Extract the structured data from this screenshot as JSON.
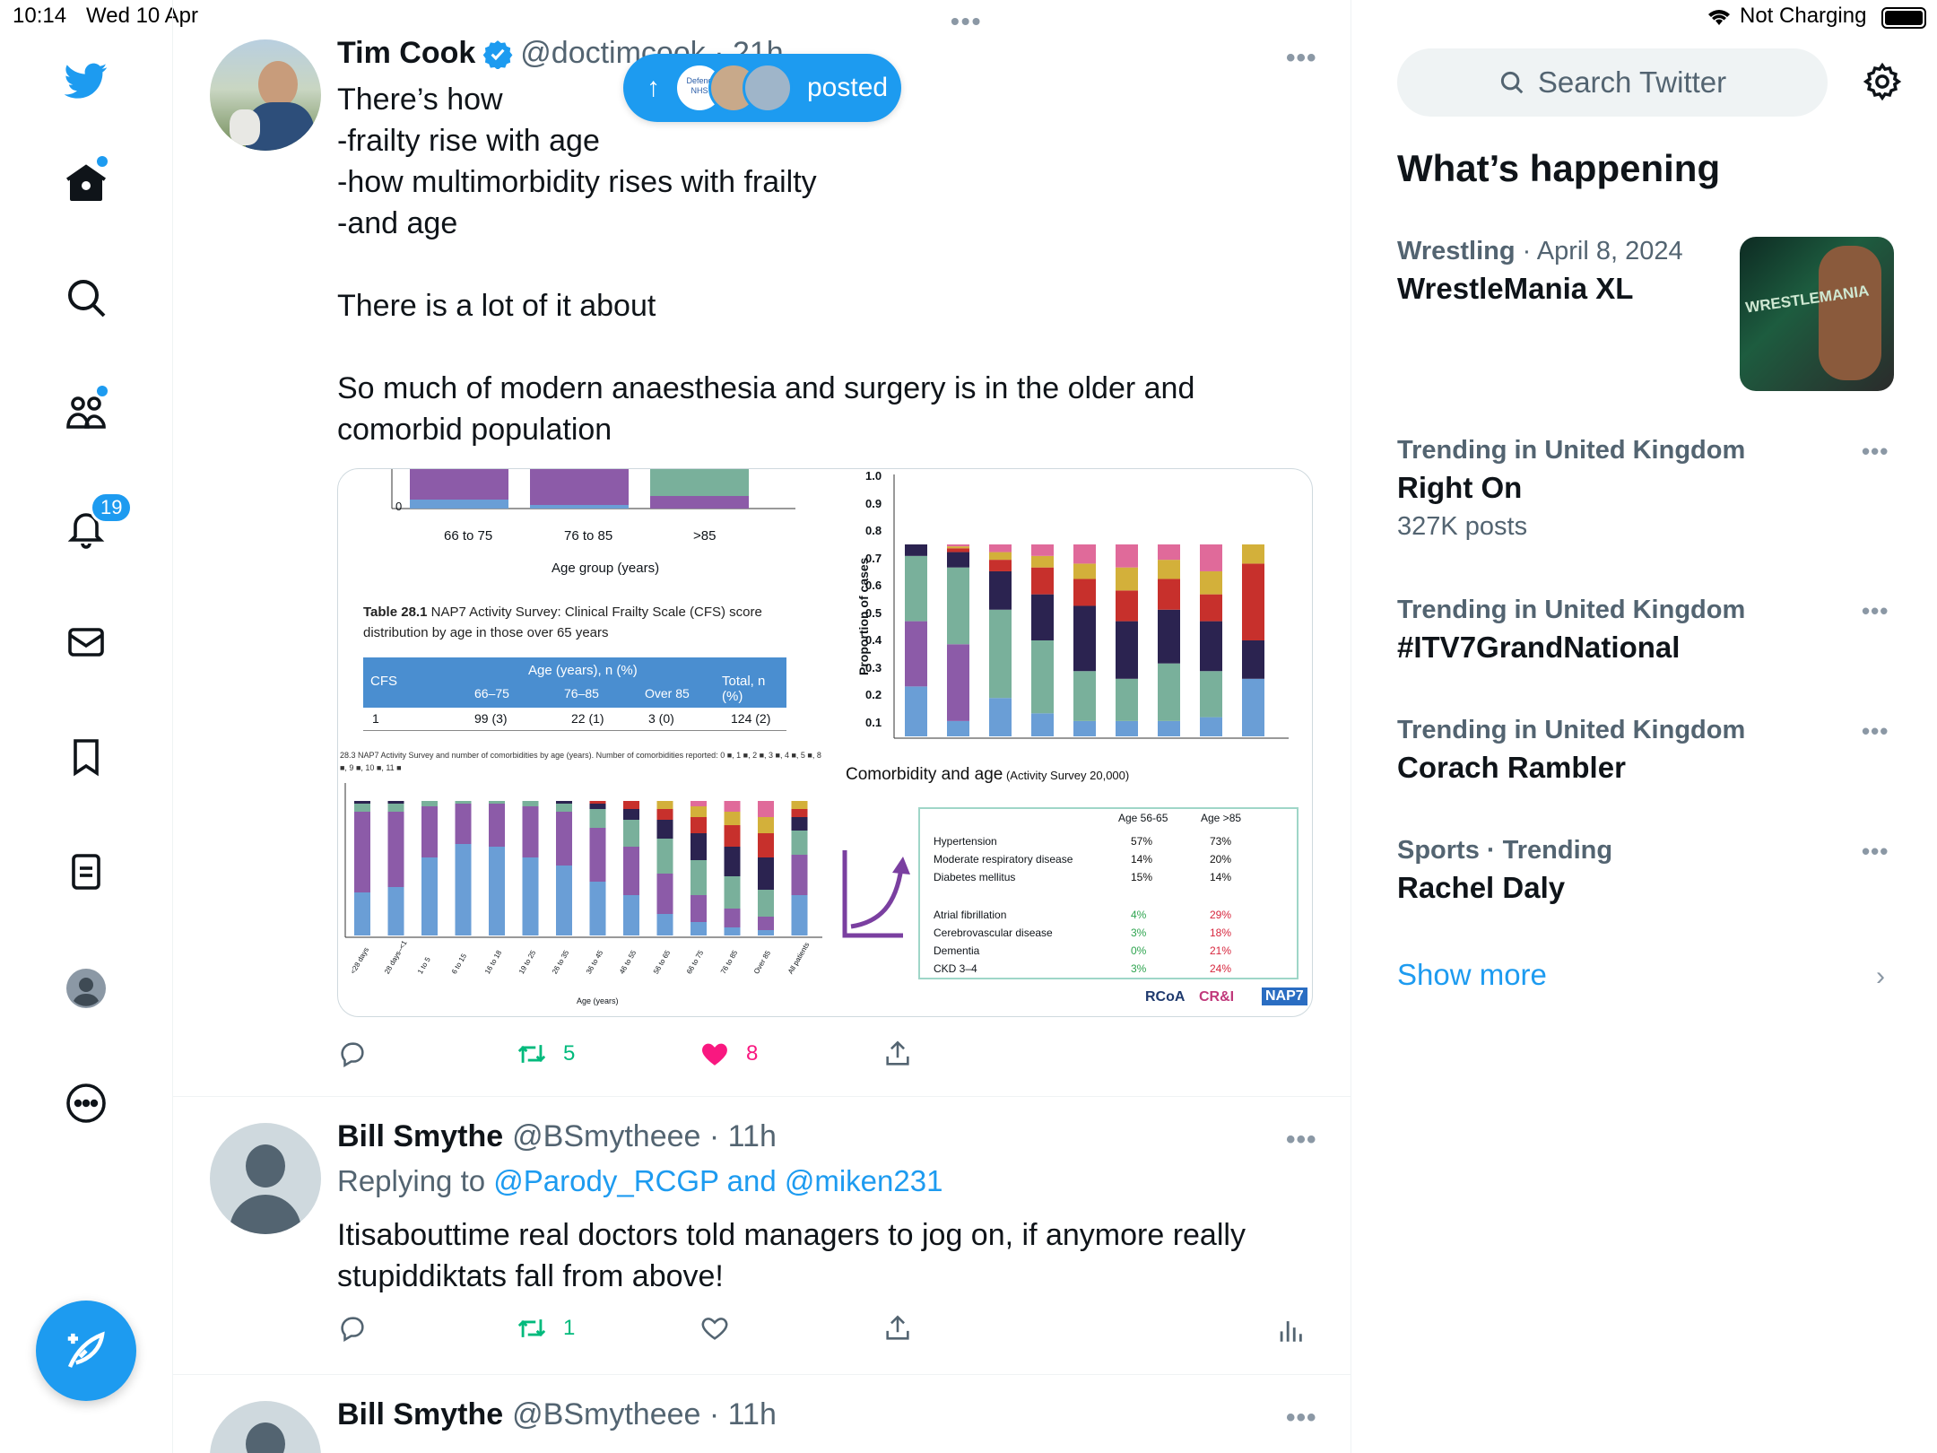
{
  "status_bar": {
    "time": "10:14",
    "date": "Wed 10 Apr",
    "battery_text": "Not Charging"
  },
  "nav": {
    "notifications_badge": "19"
  },
  "pill": {
    "label": "posted",
    "avatar_text": "Defend NHS"
  },
  "tweet1": {
    "name": "Tim Cook",
    "handle": "@doctimcook · 21h",
    "text": "There’s how\n-frailty rise with age\n-how multimorbidity rises with frailty\n-and age\n\nThere is a lot of it about\n\nSo much of modern anaesthesia and surgery is in the older and\ncomorbid population",
    "retweets": "5",
    "likes": "8"
  },
  "tweet2": {
    "name": "Bill Smythe",
    "handle": "@BSmytheee · 11h",
    "replying_prefix": "Replying to",
    "replying_users": "@Parody_RCGP and @miken231",
    "text": "Itisabouttime real doctors told managers to jog on, if anymore really\nstupiddiktats fall from above!",
    "retweets": "1"
  },
  "tweet3": {
    "name": "Bill Smythe",
    "handle": "@BSmytheee · 11h"
  },
  "media": {
    "top_left": {
      "y_zero": "0",
      "categories": [
        "66 to 75",
        "76 to 85",
        ">85"
      ],
      "xlabel": "Age group (years)"
    },
    "table": {
      "caption_bold": "Table 28.1",
      "caption": " NAP7 Activity Survey: Clinical Frailty Scale (CFS) score distribution by age in those over 65 years",
      "header_cfs": "CFS",
      "header_age": "Age (years), n (%)",
      "header_total": "Total, n (%)",
      "sub_headers": [
        "66–75",
        "76–85",
        "Over 85"
      ],
      "row": [
        "1",
        "99 (3)",
        "22 (1)",
        "3 (0)",
        "124 (2)"
      ]
    },
    "bottom_left": {
      "caption": "28.3 NAP7 Activity Survey and number of comorbidities by age (years). Number of comorbidities reported: 0 ■, 1 ■, 2 ■, 3 ■, 4 ■, 5 ■, 8 ■, 9 ■, 10 ■, 11 ■",
      "xlabels": [
        "<28 days",
        "28 days–<1",
        "1 to 5",
        "6 to 15",
        "16 to 18",
        "19 to 25",
        "26 to 35",
        "36 to 45",
        "46 to 55",
        "56 to 65",
        "66 to 75",
        "76 to 85",
        "Over 85",
        "All patients"
      ],
      "xlabel": "Age (years)"
    },
    "top_right": {
      "ylabel": "Proportion of cases",
      "yticks": [
        "1.0",
        "0.9",
        "0.8",
        "0.7",
        "0.6",
        "0.5",
        "0.4",
        "0.3",
        "0.2",
        "0.1"
      ]
    },
    "comorbidity": {
      "title": "Comorbidity and age",
      "subtitle": " (Activity Survey 20,000)",
      "col1": "Age 56-65",
      "col2": "Age >85",
      "rows": [
        [
          "Hypertension",
          "57%",
          "73%"
        ],
        [
          "Moderate respiratory disease",
          "14%",
          "20%"
        ],
        [
          "Diabetes mellitus",
          "15%",
          "14%"
        ],
        [
          "Atrial fibrillation",
          "4%",
          "29%"
        ],
        [
          "Cerebrovascular disease",
          "3%",
          "18%"
        ],
        [
          "Dementia",
          "0%",
          "21%"
        ],
        [
          "CKD 3–4",
          "3%",
          "24%"
        ]
      ]
    },
    "logos": [
      "RCoA",
      "CR&I",
      "NAP7"
    ]
  },
  "right": {
    "search_placeholder": "Search Twitter",
    "section_title": "What’s happening",
    "trends": [
      {
        "meta_cat": "Wrestling",
        "meta_rest": " · April 8, 2024",
        "name": "WrestleMania XL",
        "count": ""
      },
      {
        "meta_cat": "Trending in United Kingdom",
        "meta_rest": "",
        "name": "Right On",
        "count": "327K posts"
      },
      {
        "meta_cat": "Trending in United Kingdom",
        "meta_rest": "",
        "name": "#ITV7GrandNational",
        "count": ""
      },
      {
        "meta_cat": "Trending in United Kingdom",
        "meta_rest": "",
        "name": "Corach Rambler",
        "count": ""
      },
      {
        "meta_cat": "Sports · Trending",
        "meta_rest": "",
        "name": "Rachel Daly",
        "count": ""
      }
    ],
    "show_more": "Show more",
    "thumb_text": "WRESTLEMANIA"
  },
  "colors": {
    "accent": "#1d9bf0",
    "like": "#f91880",
    "retweet": "#00ba7c"
  }
}
